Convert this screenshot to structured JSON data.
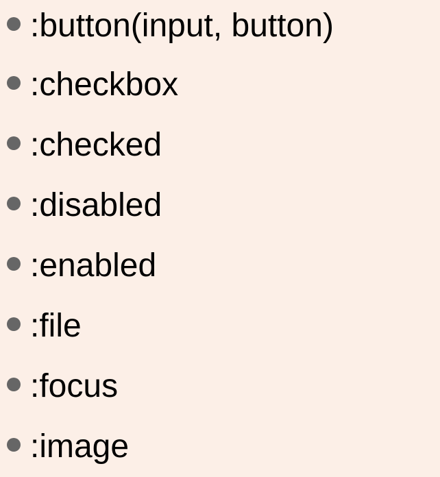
{
  "colors": {
    "background": "#fcefe7",
    "bullet": "#666666",
    "text": "#000000"
  },
  "list": {
    "items": [
      {
        "icon": "bullet-icon",
        "label": ":button(input, button)"
      },
      {
        "icon": "bullet-icon",
        "label": ":checkbox"
      },
      {
        "icon": "bullet-icon",
        "label": ":checked"
      },
      {
        "icon": "bullet-icon",
        "label": ":disabled"
      },
      {
        "icon": "bullet-icon",
        "label": ":enabled"
      },
      {
        "icon": "bullet-icon",
        "label": ":file"
      },
      {
        "icon": "bullet-icon",
        "label": ":focus"
      },
      {
        "icon": "bullet-icon",
        "label": ":image"
      }
    ]
  }
}
